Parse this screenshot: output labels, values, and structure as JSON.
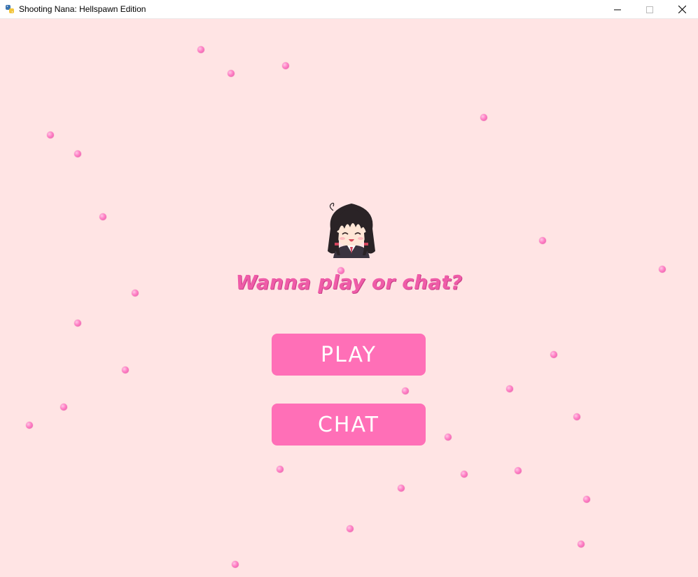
{
  "window": {
    "title": "Shooting Nana: Hellspawn Edition",
    "app_icon": "python-icon",
    "controls": [
      "minimize-icon",
      "maximize-icon",
      "close-icon"
    ]
  },
  "game": {
    "prompt": "Wanna play or chat?",
    "play_label": "PLAY",
    "chat_label": "CHAT",
    "character": "nana-chibi-avatar",
    "colors": {
      "background": "#ffe4e4",
      "button": "#ff6fb7",
      "prompt_text": "#ef5ca8",
      "particle": "#ff7fc4"
    }
  }
}
